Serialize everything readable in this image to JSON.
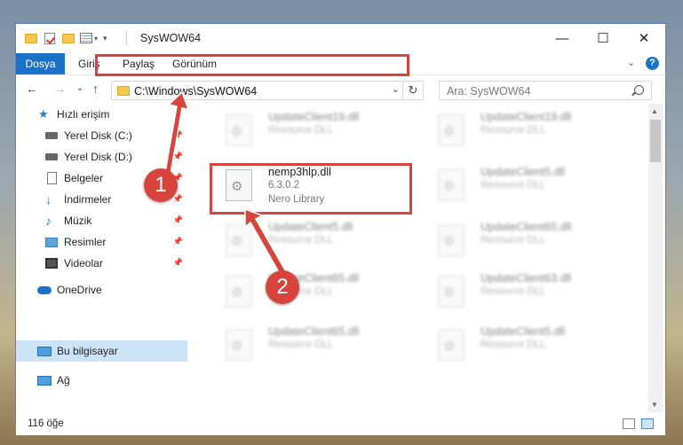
{
  "window": {
    "title": "SysWOW64",
    "controls": {
      "minimize": "—",
      "maximize": "☐",
      "close": "✕"
    }
  },
  "ribbon": {
    "tabs": [
      "Dosya",
      "Giriş",
      "Paylaş",
      "Görünüm"
    ],
    "collapse": "⌄",
    "help": "?"
  },
  "navigation": {
    "back": "←",
    "forward": "→",
    "recent": "⌄",
    "up": "↑",
    "address": "C:\\Windows\\SysWOW64",
    "address_dropdown": "⌄",
    "refresh": "↻",
    "search_placeholder": "Ara: SysWOW64"
  },
  "sidebar": {
    "items": [
      {
        "label": "Hızlı erişim",
        "icon": "star-icon"
      },
      {
        "label": "Yerel Disk (C:)",
        "icon": "drive-icon",
        "pinned": true
      },
      {
        "label": "Yerel Disk (D:)",
        "icon": "drive-icon",
        "pinned": true
      },
      {
        "label": "Belgeler",
        "icon": "documents-icon",
        "pinned": true
      },
      {
        "label": "İndirmeler",
        "icon": "downloads-icon",
        "pinned": true
      },
      {
        "label": "Müzik",
        "icon": "music-icon",
        "pinned": true
      },
      {
        "label": "Resimler",
        "icon": "pictures-icon",
        "pinned": true
      },
      {
        "label": "Videolar",
        "icon": "videos-icon",
        "pinned": true
      },
      {
        "label": "OneDrive",
        "icon": "cloud-icon"
      },
      {
        "label": "Bu bilgisayar",
        "icon": "computer-icon",
        "selected": true
      },
      {
        "label": "Ağ",
        "icon": "network-icon"
      }
    ]
  },
  "files": {
    "highlighted": {
      "name": "nemp3hlp.dll",
      "version": "6.3.0.2",
      "description": "Nero Library"
    },
    "left_column": [
      {
        "name": "UpdateClient19.dll",
        "type": "Resource DLL"
      },
      {
        "name": "UpdateClient5.dll",
        "type": "Resource DLL"
      },
      {
        "name": "UpdateClient65.dll",
        "type": "Resource DLL"
      },
      {
        "name": "UpdateClient65.dll",
        "type": "Resource DLL"
      }
    ],
    "right_column": [
      {
        "name": "UpdateClient19.dll",
        "type": "Resource DLL"
      },
      {
        "name": "UpdateClient5.dll",
        "type": "Resource DLL"
      },
      {
        "name": "UpdateClient65.dll",
        "type": "Resource DLL"
      },
      {
        "name": "UpdateClient63.dll",
        "type": "Resource DLL"
      },
      {
        "name": "UpdateClient5.dll",
        "type": "Resource DLL"
      }
    ]
  },
  "status": {
    "count": "116 öğe"
  },
  "annotations": {
    "step1": "1",
    "step2": "2",
    "color": "#d7443c"
  }
}
